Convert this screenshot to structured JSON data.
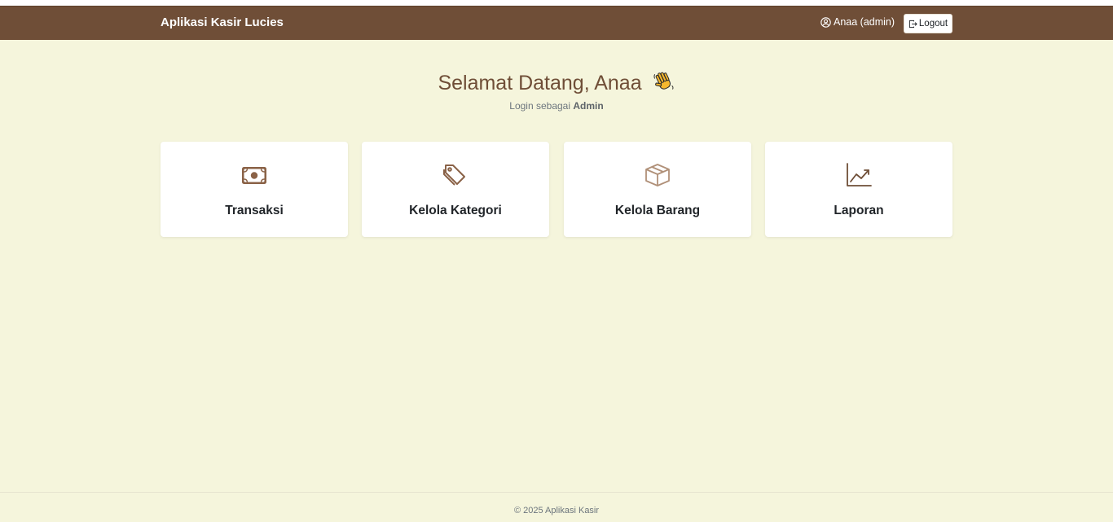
{
  "navbar": {
    "brand": "Aplikasi Kasir Lucies",
    "user_label": "Anaa (admin)",
    "user_icon": "person-circle-icon",
    "logout_label": "Logout",
    "logout_icon": "box-arrow-right-icon",
    "background_color": "#6f4e37"
  },
  "welcome": {
    "title": "Selamat Datang, Anaa",
    "emoji": "👋",
    "login_prefix": "Login sebagai",
    "role": "Admin"
  },
  "menu": [
    {
      "label": "Transaksi",
      "icon": "cash-icon"
    },
    {
      "label": "Kelola Kategori",
      "icon": "tags-icon"
    },
    {
      "label": "Kelola Barang",
      "icon": "box-icon"
    },
    {
      "label": "Laporan",
      "icon": "graph-up-icon"
    }
  ],
  "footer": {
    "text": "© 2025 Aplikasi Kasir"
  },
  "colors": {
    "accent": "#6f4e37",
    "page_background": "#f5f5dc",
    "card_background": "#ffffff"
  }
}
